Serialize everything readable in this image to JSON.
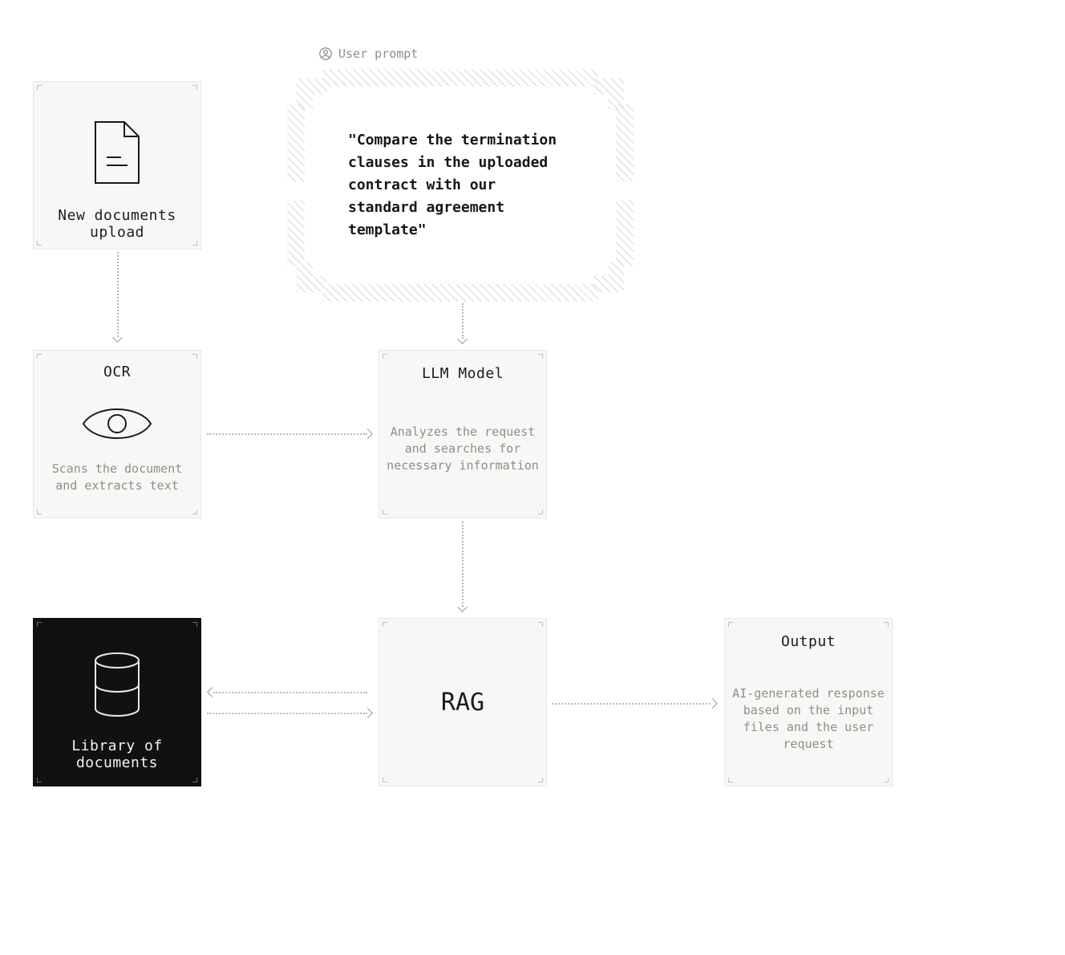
{
  "prompt": {
    "label": "User prompt",
    "text": "\"Compare the termination clauses in the uploaded contract with our standard agreement template\""
  },
  "nodes": {
    "upload": {
      "title": "New documents upload"
    },
    "ocr": {
      "title": "OCR",
      "sub": "Scans the document and extracts text"
    },
    "llm": {
      "title": "LLM Model",
      "sub": "Analyzes the request and searches for necessary information"
    },
    "library": {
      "title": "Library of documents"
    },
    "rag": {
      "title": "RAG"
    },
    "output": {
      "title": "Output",
      "sub": "AI-generated response based on the input files and the user request"
    }
  }
}
